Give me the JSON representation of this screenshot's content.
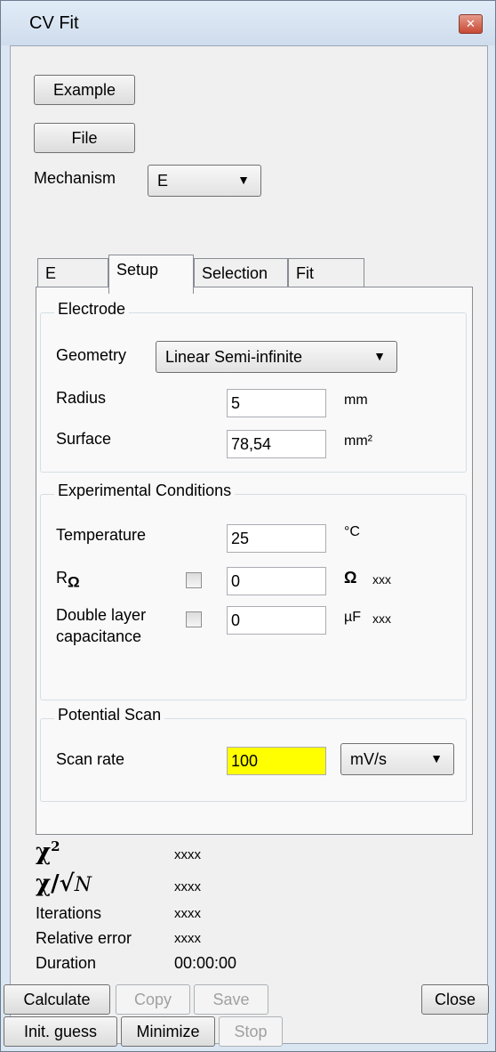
{
  "window": {
    "title": "CV Fit"
  },
  "top_buttons": {
    "example": "Example",
    "file": "File"
  },
  "mechanism": {
    "label": "Mechanism",
    "value": "E"
  },
  "tabs": [
    {
      "label": "E"
    },
    {
      "label": "Setup"
    },
    {
      "label": "Selection"
    },
    {
      "label": "Fit"
    }
  ],
  "electrode": {
    "title": "Electrode",
    "geometry_label": "Geometry",
    "geometry_value": "Linear Semi-infinite",
    "radius_label": "Radius",
    "radius_value": "5",
    "radius_unit": "mm",
    "surface_label": "Surface",
    "surface_value": "78,54",
    "surface_unit": "mm²"
  },
  "conditions": {
    "title": "Experimental Conditions",
    "temperature_label": "Temperature",
    "temperature_value": "25",
    "temperature_unit": "°C",
    "r_label": "R",
    "r_sub": "Ω",
    "r_value": "0",
    "r_unit": "Ω",
    "r_extra": "xxx",
    "dl_label_1": "Double layer",
    "dl_label_2": "capacitance",
    "dl_value": "0",
    "dl_unit": "µF",
    "dl_extra": "xxx"
  },
  "scan": {
    "title": "Potential Scan",
    "rate_label": "Scan rate",
    "rate_value": "100",
    "rate_unit": "mV/s"
  },
  "stats": {
    "chi2_value": "xxxx",
    "chi_n_value": "xxxx",
    "iterations_label": "Iterations",
    "iterations_value": "xxxx",
    "relerr_label": "Relative error",
    "relerr_value": "xxxx",
    "duration_label": "Duration",
    "duration_value": "00:00:00"
  },
  "bottom_buttons": {
    "calculate": "Calculate",
    "copy": "Copy",
    "save": "Save",
    "close": "Close",
    "init_guess": "Init. guess",
    "minimize": "Minimize",
    "stop": "Stop"
  }
}
